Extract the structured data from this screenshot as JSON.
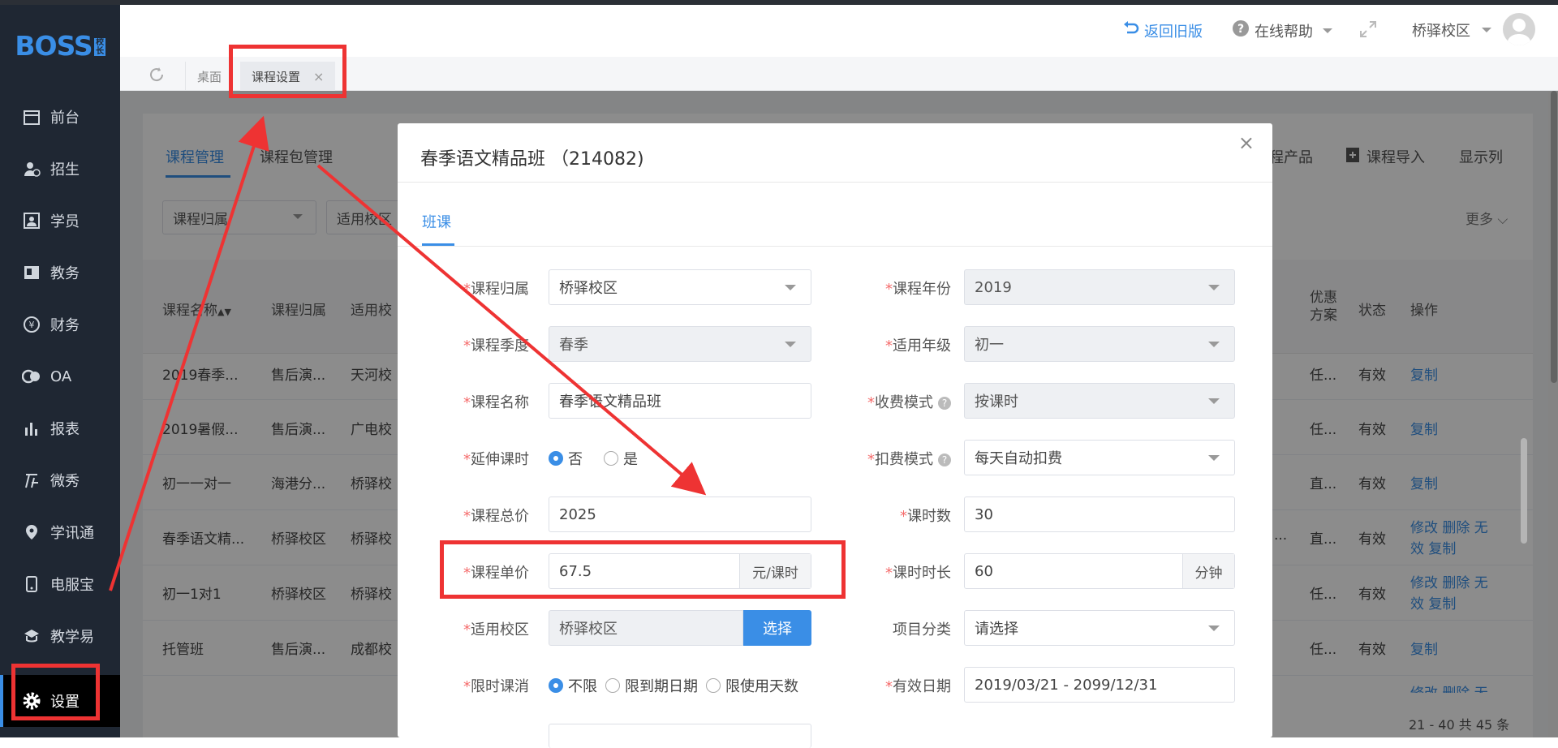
{
  "brand": {
    "logo": "BOSS",
    "logo_badge": "校长"
  },
  "sidebar": {
    "items": [
      {
        "label": "前台",
        "icon": "calendar-icon"
      },
      {
        "label": "招生",
        "icon": "user-add-icon"
      },
      {
        "label": "学员",
        "icon": "id-card-icon"
      },
      {
        "label": "教务",
        "icon": "book-icon"
      },
      {
        "label": "财务",
        "icon": "yen-icon"
      },
      {
        "label": "OA",
        "icon": "oa-icon"
      },
      {
        "label": "报表",
        "icon": "bar-chart-icon"
      },
      {
        "label": "微秀",
        "icon": "weixiu-icon"
      },
      {
        "label": "学讯通",
        "icon": "location-icon"
      },
      {
        "label": "电服宝",
        "icon": "phone-icon"
      },
      {
        "label": "教学易",
        "icon": "teach-icon"
      },
      {
        "label": "设置",
        "icon": "gear-icon"
      }
    ]
  },
  "header": {
    "back_old": "返回旧版",
    "help": "在线帮助",
    "campus": "桥驿校区"
  },
  "tabs": {
    "desktop": "桌面",
    "course_settings": "课程设置",
    "close": "×"
  },
  "panel": {
    "tab_course": "课程管理",
    "tab_package": "课程包管理",
    "action_product": "程产品",
    "action_import": "课程导入",
    "action_columns": "显示列",
    "more": "更多",
    "filter_owner": "课程归属",
    "filter_campus": "适用校区",
    "columns": {
      "name": "课程名称",
      "owner": "课程归属",
      "campus": "适用校",
      "discount": "优惠方案",
      "status": "状态",
      "ops": "操作"
    },
    "rows": [
      {
        "name": "2019春季...",
        "owner": "售后演...",
        "campus": "天河校",
        "d": "任...",
        "status": "有效",
        "op": "复制"
      },
      {
        "name": "2019暑假...",
        "owner": "售后演...",
        "campus": "广电校",
        "d": "任...",
        "status": "有效",
        "op": "复制"
      },
      {
        "name": "初一一对一",
        "owner": "海港分...",
        "campus": "桥驿校",
        "d": "直...",
        "status": "有效",
        "op": "复制"
      },
      {
        "name": "春季语文精...",
        "owner": "桥驿校区",
        "campus": "桥驿校",
        "d": "直...",
        "status": "有效",
        "op": "修改 删除 无",
        "op2": "效 复制"
      },
      {
        "name": "初一1对1",
        "owner": "桥驿校区",
        "campus": "桥驿校",
        "d": "任...",
        "status": "有效",
        "op": "修改 删除 无",
        "op2": "效 复制"
      },
      {
        "name": "托管班",
        "owner": "售后演...",
        "campus": "成都校",
        "d": "任...",
        "status": "有效",
        "op": "复制"
      }
    ],
    "extra_ellipsis": "...",
    "last_partial_op": "修改 删除 无",
    "pagination": "21 - 40  共 45 条"
  },
  "modal": {
    "title": "春季语文精品班 （214082)",
    "close": "×",
    "tab": "班课",
    "fields": {
      "owner_label": "课程归属",
      "owner_value": "桥驿校区",
      "year_label": "课程年份",
      "year_value": "2019",
      "season_label": "课程季度",
      "season_value": "春季",
      "grade_label": "适用年级",
      "grade_value": "初一",
      "name_label": "课程名称",
      "name_value": "春季语文精品班",
      "charge_label": "收费模式",
      "charge_value": "按课时",
      "extend_label": "延伸课时",
      "extend_no": "否",
      "extend_yes": "是",
      "deduct_label": "扣费模式",
      "deduct_value": "每天自动扣费",
      "total_label": "课程总价",
      "total_value": "2025",
      "hours_label": "课时数",
      "hours_value": "30",
      "unit_label": "课程单价",
      "unit_value": "67.5",
      "unit_suffix": "元/课时",
      "duration_label": "课时时长",
      "duration_value": "60",
      "duration_suffix": "分钟",
      "campus_label": "适用校区",
      "campus_value": "桥驿校区",
      "campus_btn": "选择",
      "category_label": "项目分类",
      "category_value": "请选择",
      "limit_label": "限时课消",
      "limit_none": "不限",
      "limit_date": "限到期日期",
      "limit_days": "限使用天数",
      "valid_label": "有效日期",
      "valid_value": "2019/03/21 - 2099/12/31"
    },
    "required_mark": "*",
    "help_mark": "?"
  }
}
